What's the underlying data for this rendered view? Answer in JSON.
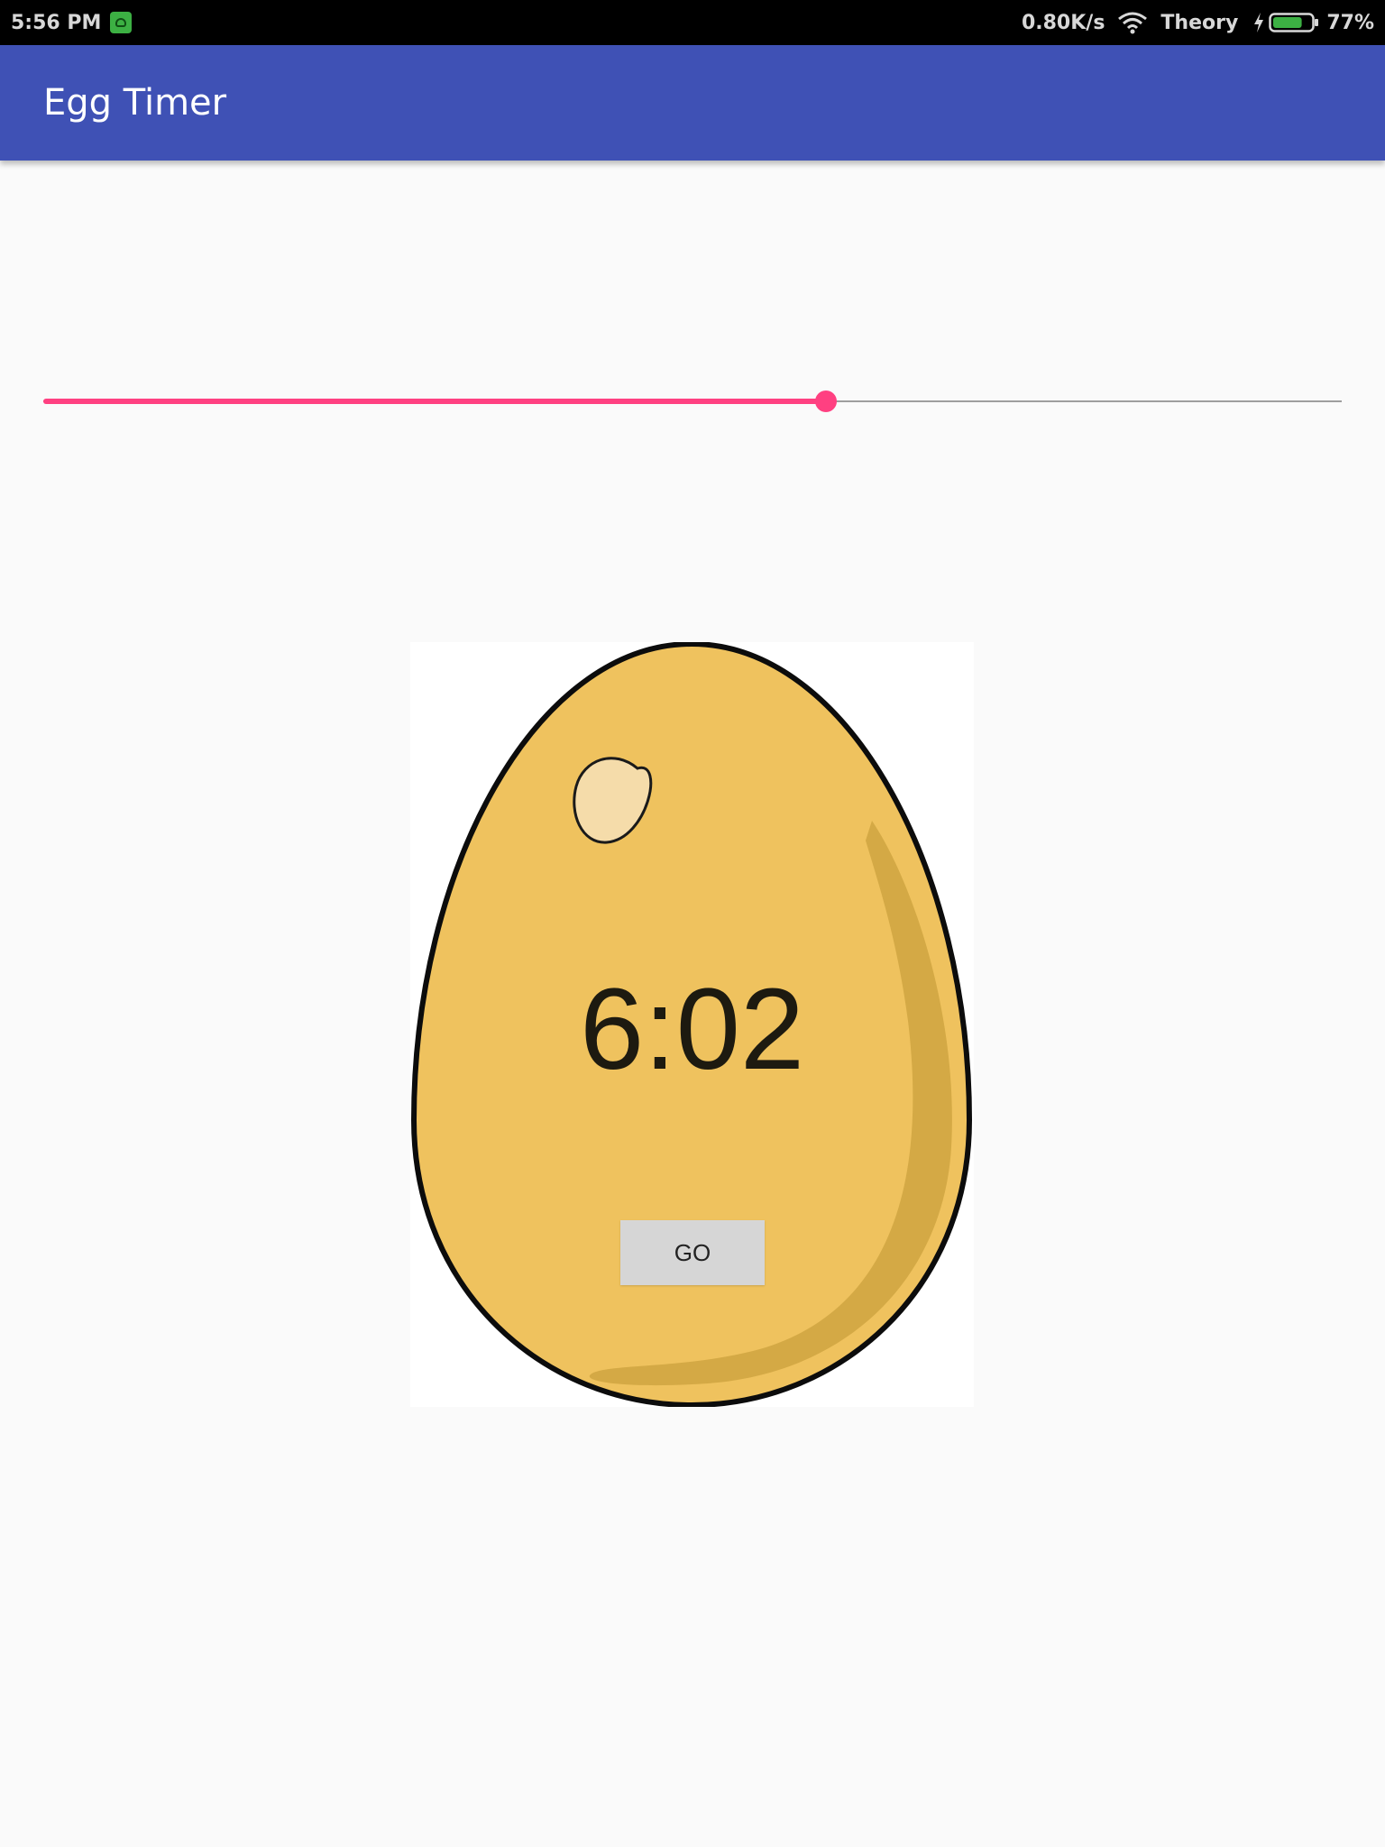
{
  "status_bar": {
    "time": "5:56 PM",
    "app_indicator_icon": "android-app-icon",
    "network_speed": "0.80K/s",
    "wifi_icon": "wifi-icon",
    "network_name": "Theory",
    "charging_icon": "lightning-bolt-icon",
    "battery_icon": "battery-icon",
    "battery_level": "77%",
    "battery_color": "#3cb043"
  },
  "app_bar": {
    "title": "Egg Timer",
    "color": "#3f51b5"
  },
  "seekbar": {
    "progress_fraction": 0.603,
    "accent_color": "#ff4081"
  },
  "timer": {
    "display": "6:02",
    "go_label": "GO"
  },
  "egg_image": {
    "icon": "egg-icon",
    "shell_color": "#efc25e",
    "shadow_color": "#d4a945",
    "highlight_color": "#f5dcaa"
  }
}
